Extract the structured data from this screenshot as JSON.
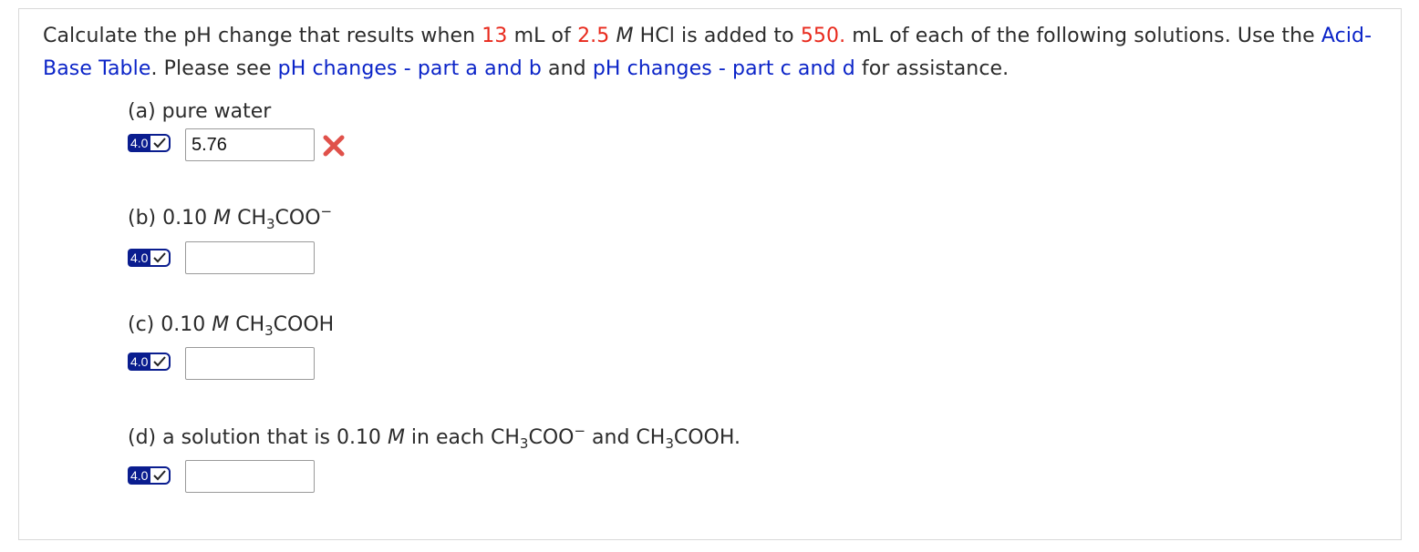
{
  "question": {
    "p1": "Calculate the pH change that results when ",
    "volume_hcl": "13",
    "p2": " mL of ",
    "conc_hcl": "2.5",
    "p3": " ",
    "unit_m": "M",
    "p4": " HCl is added to ",
    "volume_solution": "550.",
    "p5": " mL of each of the following solutions. Use the ",
    "link_table": "Acid-Base Table",
    "p6": ". Please see ",
    "link_ab": "pH changes - part a and b",
    "p7": " and ",
    "link_cd": "pH changes - part c and d",
    "p8": " for assistance."
  },
  "parts": {
    "a": {
      "label": "(a) pure water",
      "points": "4.0",
      "answer": "5.76",
      "status": "incorrect"
    },
    "b": {
      "prefix": "(b) 0.10 ",
      "m": "M",
      "formula_a": "CH",
      "formula_sub": "3",
      "formula_b": "COO",
      "charge": "−",
      "points": "4.0",
      "answer": ""
    },
    "c": {
      "prefix": "(c) 0.10 ",
      "m": "M",
      "formula_a": "CH",
      "formula_sub": "3",
      "formula_b": "COOH",
      "points": "4.0",
      "answer": ""
    },
    "d": {
      "prefix": "(d) a solution that is 0.10 ",
      "m": "M",
      "mid": " in each CH",
      "sub1": "3",
      "f1": "COO",
      "charge": "−",
      "and": " and CH",
      "sub2": "3",
      "f2": "COOH.",
      "points": "4.0",
      "answer": ""
    }
  },
  "colors": {
    "value_red": "#e8291c",
    "link_blue": "#0b24c8",
    "badge_navy": "#0a1d8f",
    "wrong_red": "#e0514a"
  },
  "icons": {
    "check": "check-icon",
    "wrong": "x-mark-icon"
  }
}
